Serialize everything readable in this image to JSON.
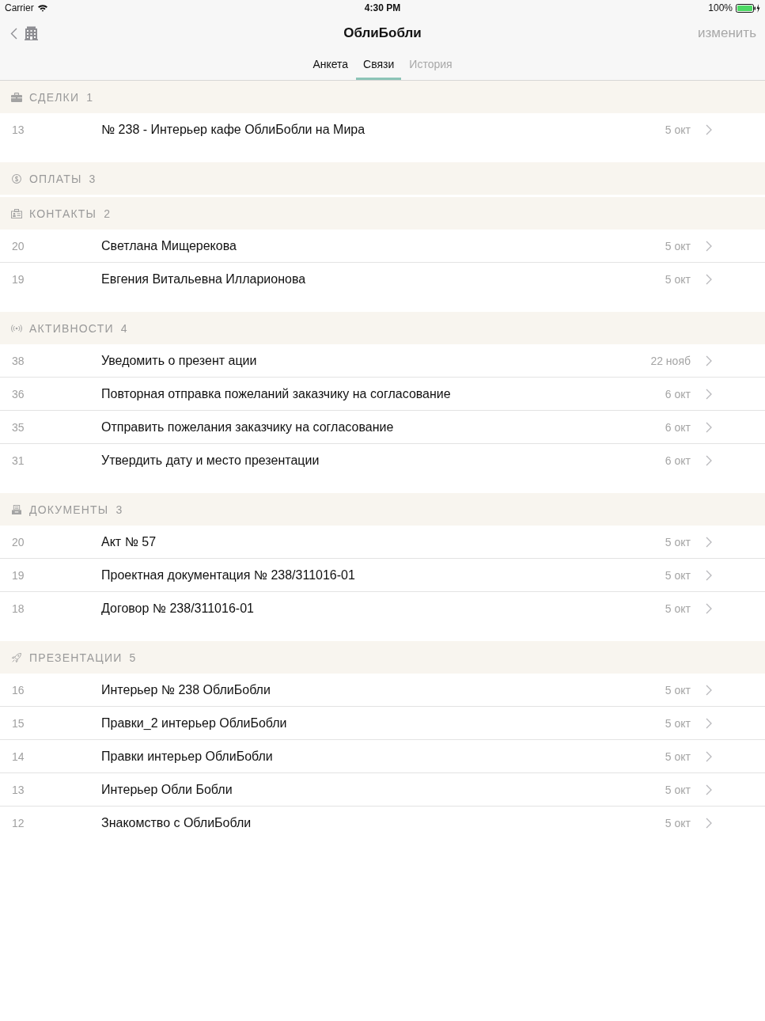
{
  "status_bar": {
    "carrier": "Carrier",
    "time": "4:30 PM",
    "battery": "100%"
  },
  "nav": {
    "title": "ОблиБобли",
    "edit": {
      "label": "изменить",
      "disabled": true
    }
  },
  "tabs": [
    {
      "label": "Анкета",
      "selected": false,
      "disabled": false
    },
    {
      "label": "Связи",
      "selected": true,
      "disabled": false
    },
    {
      "label": "История",
      "selected": false,
      "disabled": true
    }
  ],
  "sections": [
    {
      "kind": "deals",
      "title": "СДЕЛКИ",
      "count": "1",
      "rows": [
        {
          "number": "13",
          "title": "№ 238 - Интерьер кафе ОблиБобли на Мира",
          "date": "5 окт"
        }
      ]
    },
    {
      "kind": "payments",
      "title": "ОПЛАТЫ",
      "count": "3"
    },
    {
      "kind": "contacts",
      "title": "КОНТАКТЫ",
      "count": "2",
      "rows": [
        {
          "number": "20",
          "title": "Светлана Мищерекова",
          "date": "5 окт"
        },
        {
          "number": "19",
          "title": "Евгения Витальевна Илларионова",
          "date": "5 окт"
        }
      ]
    },
    {
      "kind": "activities",
      "title": "АКТИВНОСТИ",
      "count": "4",
      "rows": [
        {
          "number": "38",
          "title": "Уведомить о презент ации",
          "date": "22 нояб"
        },
        {
          "number": "36",
          "title": "Повторная отправка пожеланий заказчику на согласование",
          "date": "6 окт"
        },
        {
          "number": "35",
          "title": "Отправить пожелания заказчику на согласование",
          "date": "6 окт"
        },
        {
          "number": "31",
          "title": "Утвердить дату и место презентации",
          "date": "6 окт"
        }
      ]
    },
    {
      "kind": "documents",
      "title": "ДОКУМЕНТЫ",
      "count": "3",
      "rows": [
        {
          "number": "20",
          "title": "Акт № 57",
          "date": "5 окт"
        },
        {
          "number": "19",
          "title": "Проектная документация № 238/311016-01",
          "date": "5 окт"
        },
        {
          "number": "18",
          "title": "Договор № 238/311016-01",
          "date": "5 окт"
        }
      ]
    },
    {
      "kind": "presentations",
      "title": "ПРЕЗЕНТАЦИИ",
      "count": "5",
      "rows": [
        {
          "number": "16",
          "title": "Интерьер № 238 ОблиБобли",
          "date": "5 окт"
        },
        {
          "number": "15",
          "title": "Правки_2 интерьер ОблиБобли",
          "date": "5 окт"
        },
        {
          "number": "14",
          "title": "Правки интерьер ОблиБобли",
          "date": "5 окт"
        },
        {
          "number": "13",
          "title": "Интерьер Обли Бобли",
          "date": "5 окт"
        },
        {
          "number": "12",
          "title": "Знакомство с ОблиБобли",
          "date": "5 окт"
        }
      ]
    }
  ]
}
